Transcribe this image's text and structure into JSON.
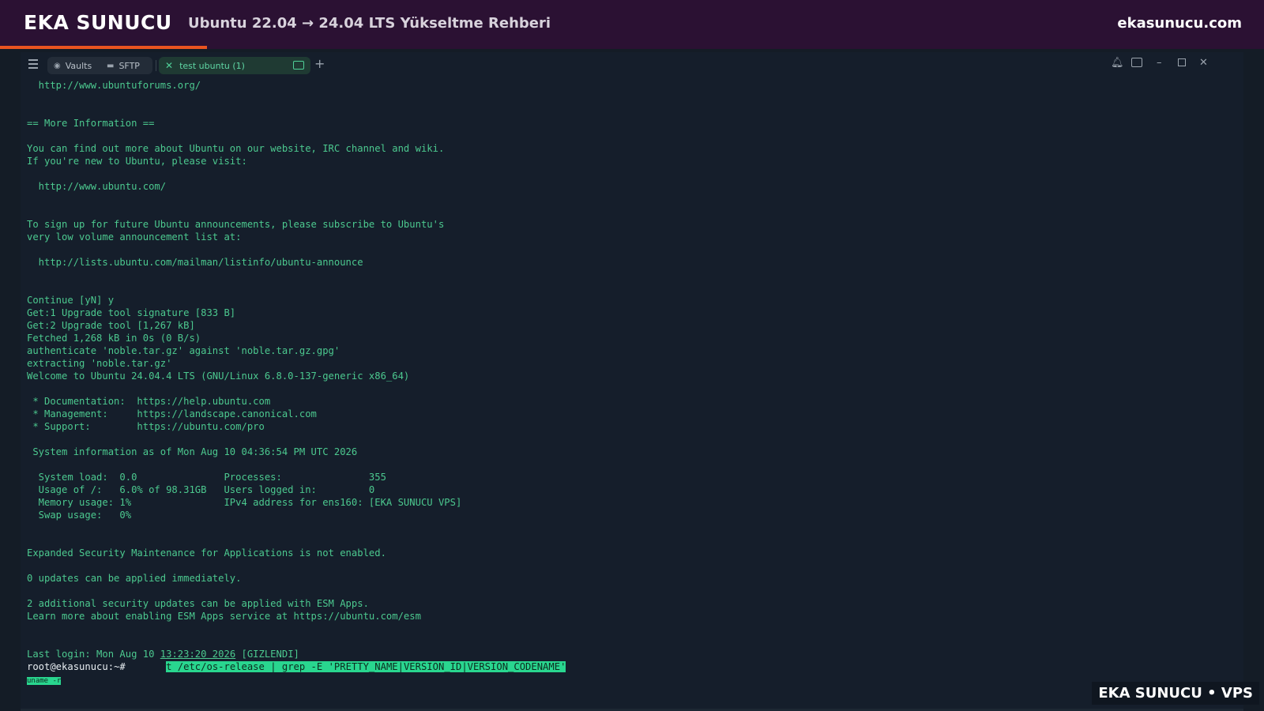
{
  "banner": {
    "brand": "EKA SUNUCU",
    "title": "Ubuntu 22.04 → 24.04 LTS Yükseltme Rehberi",
    "site": "ekasunucu.com"
  },
  "tabs": {
    "vaults": "Vaults",
    "sftp": "SFTP",
    "active": "test ubuntu (1)"
  },
  "terminal": {
    "lines": [
      "  http://www.ubuntuforums.org/",
      "",
      "",
      "== More Information ==",
      "",
      "You can find out more about Ubuntu on our website, IRC channel and wiki.",
      "If you're new to Ubuntu, please visit:",
      "",
      "  http://www.ubuntu.com/",
      "",
      "",
      "To sign up for future Ubuntu announcements, please subscribe to Ubuntu's",
      "very low volume announcement list at:",
      "",
      "  http://lists.ubuntu.com/mailman/listinfo/ubuntu-announce",
      "",
      "",
      "Continue [yN] y",
      "Get:1 Upgrade tool signature [833 B]",
      "Get:2 Upgrade tool [1,267 kB]",
      "Fetched 1,268 kB in 0s (0 B/s)",
      "authenticate 'noble.tar.gz' against 'noble.tar.gz.gpg'",
      "extracting 'noble.tar.gz'",
      "Welcome to Ubuntu 24.04.4 LTS (GNU/Linux 6.8.0-137-generic x86_64)",
      "",
      " * Documentation:  https://help.ubuntu.com",
      " * Management:     https://landscape.canonical.com",
      " * Support:        https://ubuntu.com/pro",
      "",
      " System information as of Mon Aug 10 04:36:54 PM UTC 2026",
      "",
      "  System load:  0.0               Processes:               355",
      "  Usage of /:   6.0% of 98.31GB   Users logged in:         0",
      "  Memory usage: 1%                IPv4 address for ens160: [EKA SUNUCU VPS]",
      "  Swap usage:   0%",
      "",
      "",
      "Expanded Security Maintenance for Applications is not enabled.",
      "",
      "0 updates can be applied immediately.",
      "",
      "2 additional security updates can be applied with ESM Apps.",
      "Learn more about enabling ESM Apps service at https://ubuntu.com/esm",
      "",
      ""
    ],
    "last_login_prefix": "Last login: Mon Aug 10 ",
    "last_login_time": "13:23:20 2026",
    "last_login_hidden": " [GIZLENDI]",
    "prompt": "root@ekasunucu:~#",
    "command": "t /etc/os-release | grep -E 'PRETTY_NAME|VERSION_ID|VERSION_CODENAME'",
    "output_fragment": "uname -r"
  },
  "watermark": "EKA SUNUCU • VPS",
  "colors": {
    "banner_bg": "#2b1133",
    "accent": "#e95420",
    "terminal_bg": "#151e2b",
    "terminal_text": "#4cc98f",
    "highlight": "#29d68f"
  }
}
